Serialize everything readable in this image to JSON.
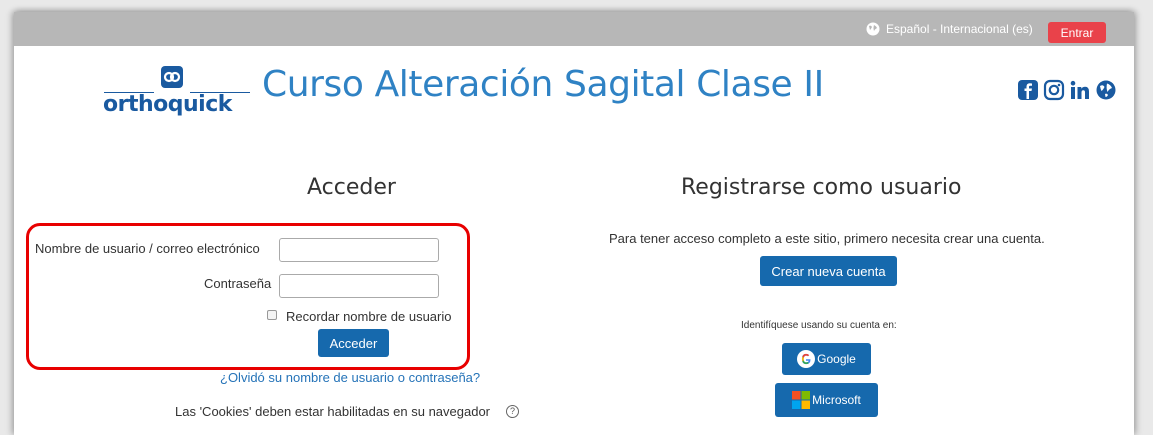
{
  "header": {
    "language_label": "Español - Internacional (es)",
    "login_button": "Entrar"
  },
  "brand": {
    "logo_text": "orthoquick",
    "site_title": "Curso Alteración Sagital Clase II",
    "social_icons": [
      "facebook-icon",
      "instagram-icon",
      "linkedin-icon",
      "globe-icon"
    ]
  },
  "login": {
    "title": "Acceder",
    "username_label": "Nombre de usuario / correo electrónico",
    "username_value": "",
    "password_label": "Contraseña",
    "password_value": "",
    "remember_label": "Recordar nombre de usuario",
    "remember_checked": false,
    "submit_label": "Acceder",
    "forgot_link": "¿Olvidó su nombre de usuario o contraseña?",
    "cookies_notice": "Las 'Cookies' deben estar habilitadas en su navegador"
  },
  "signup": {
    "title": "Registrarse como usuario",
    "description": "Para tener acceso completo a este sitio, primero necesita crear una cuenta.",
    "create_button": "Crear nueva cuenta",
    "identify_text": "Identifíquese usando su cuenta en:",
    "providers": [
      {
        "label": "Google",
        "icon": "google-icon"
      },
      {
        "label": "Microsoft",
        "icon": "microsoft-icon"
      }
    ]
  },
  "colors": {
    "accent_blue": "#1669ad",
    "title_blue": "#2f82c4",
    "login_red": "#e9424a",
    "highlight_red": "#e80000",
    "topbar_gray": "#b7b7b7"
  }
}
